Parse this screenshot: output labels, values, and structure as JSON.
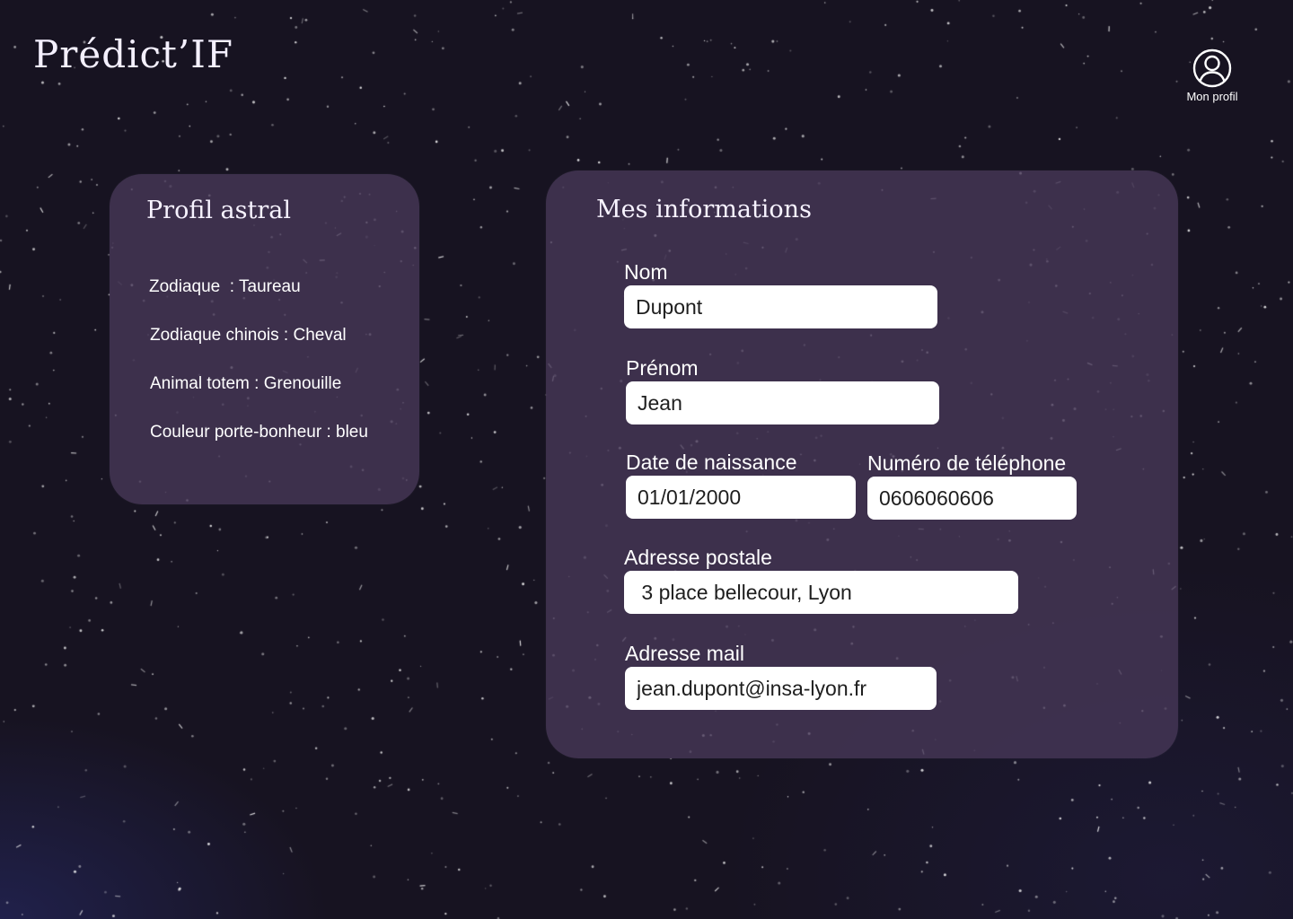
{
  "app": {
    "logo": "Prédict’IF"
  },
  "header": {
    "profile_label": "Mon profil",
    "profile_icon": "user-circle-icon"
  },
  "astral_profile": {
    "title": "Profil astral",
    "items": [
      "Zodiaque  : Taureau",
      "Zodiaque chinois : Cheval",
      "Animal totem : Grenouille",
      "Couleur porte-bonheur : bleu"
    ]
  },
  "personal_info": {
    "title": "Mes informations",
    "fields": {
      "nom": {
        "label": "Nom",
        "value": "Dupont"
      },
      "prenom": {
        "label": "Prénom",
        "value": "Jean"
      },
      "date_naissance": {
        "label": "Date de naissance",
        "value": "01/01/2000"
      },
      "telephone": {
        "label": "Numéro de téléphone",
        "value": "0606060606"
      },
      "adresse": {
        "label": "Adresse postale",
        "value": " 3 place bellecour, Lyon"
      },
      "mail": {
        "label": "Adresse mail",
        "value": "jean.dupont@insa-lyon.fr"
      }
    }
  },
  "colors": {
    "background": "#171321",
    "card": "#483858",
    "input_background": "#ffffff",
    "text": "#ffffff"
  }
}
